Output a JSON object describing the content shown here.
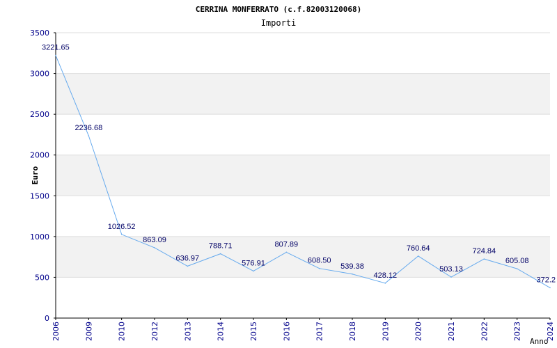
{
  "chart_data": {
    "type": "line",
    "title": "CERRINA MONFERRATO (c.f.82003120068)",
    "subtitle": "Importi",
    "xlabel": "Anno",
    "ylabel": "Euro",
    "ylim": [
      0,
      3500
    ],
    "yticks": [
      0,
      500,
      1000,
      1500,
      2000,
      2500,
      3000,
      3500
    ],
    "grid": true,
    "categories": [
      "2006",
      "2009",
      "2010",
      "2012",
      "2013",
      "2014",
      "2015",
      "2016",
      "2017",
      "2018",
      "2019",
      "2020",
      "2021",
      "2022",
      "2023",
      "2024"
    ],
    "values": [
      3221.65,
      2236.68,
      1026.52,
      863.09,
      636.97,
      788.71,
      576.91,
      807.89,
      608.5,
      539.38,
      428.12,
      760.64,
      503.13,
      724.84,
      605.08,
      372.2
    ],
    "data_labels": [
      "3221.65",
      "2236.68",
      "1026.52",
      "863.09",
      "636.97",
      "788.71",
      "576.91",
      "807.89",
      "608.50",
      "539.38",
      "428.12",
      "760.64",
      "503.13",
      "724.84",
      "605.08",
      "372.2"
    ],
    "colors": {
      "line": "#66aaee",
      "band": "#f2f2f2",
      "grid": "#dddddd",
      "axis": "#000000",
      "tick_text": "#00008b",
      "data_label": "#000066"
    }
  }
}
